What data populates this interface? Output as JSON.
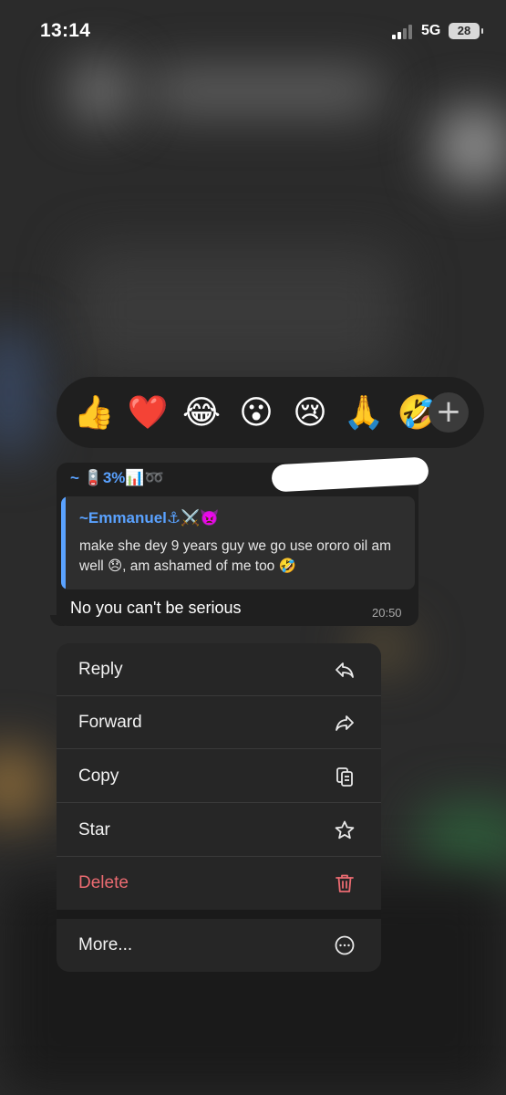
{
  "status_bar": {
    "time": "13:14",
    "network": "5G",
    "battery": "28"
  },
  "reactions": {
    "emojis": [
      "👍",
      "❤️",
      "😂",
      "😮",
      "😢",
      "🙏",
      "🤣"
    ],
    "more_label": "+"
  },
  "message": {
    "sender": "~ 🪫3%📊➿",
    "quote": {
      "author": "~Emmanuel⚓⚔️👿",
      "text": "make she dey 9 years guy we go use ororo oil am well 😞, am ashamed of me too 🤣"
    },
    "text": "No you can't be serious",
    "time": "20:50"
  },
  "menu": {
    "items": [
      {
        "label": "Reply",
        "icon": "reply-icon"
      },
      {
        "label": "Forward",
        "icon": "forward-icon"
      },
      {
        "label": "Copy",
        "icon": "copy-icon"
      },
      {
        "label": "Star",
        "icon": "star-icon"
      },
      {
        "label": "Delete",
        "icon": "trash-icon"
      },
      {
        "label": "More...",
        "icon": "more-icon"
      }
    ],
    "delete_color": "#eb6b71",
    "accent_color": "#5aa2ff"
  }
}
